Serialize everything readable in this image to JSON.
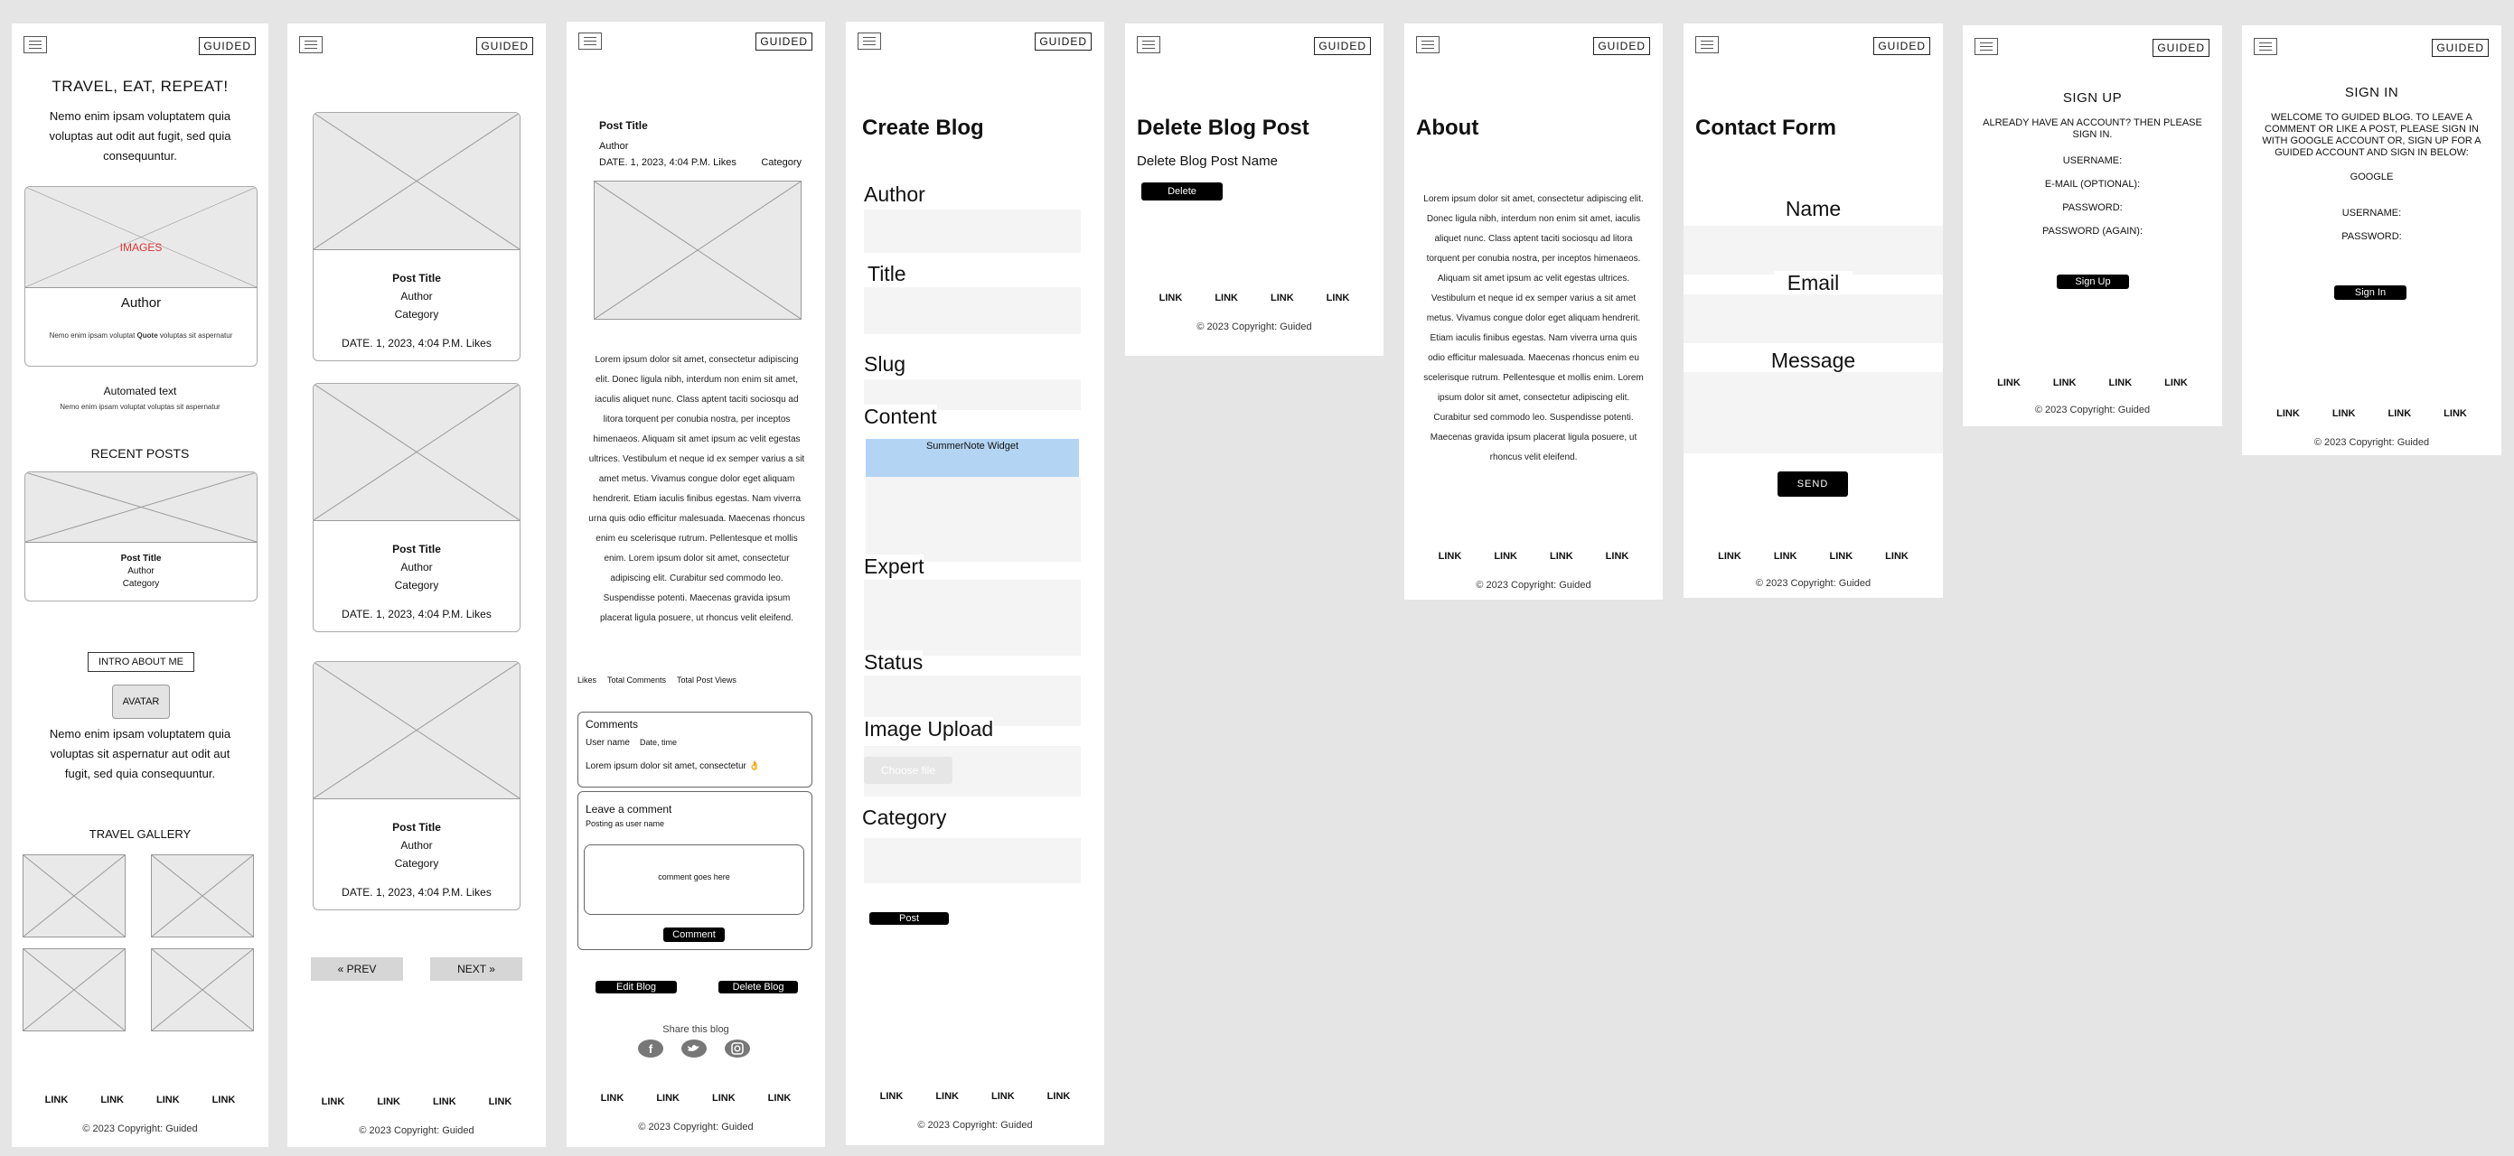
{
  "brand": "GUIDED",
  "footer": {
    "links": [
      "LINK",
      "LINK",
      "LINK",
      "LINK"
    ],
    "copyright": "© 2023 Copyright: Guided"
  },
  "home": {
    "title": "TRAVEL, EAT, REPEAT!",
    "intro": "Nemo enim ipsam voluptatem quia voluptas  aut odit aut fugit, sed quia consequuntur.",
    "featured_label": "IMAGES",
    "featured_author": "Author",
    "featured_quote_pre": "Nemo enim ipsam voluptat",
    "featured_quote_bold": "Quote",
    "featured_quote_post": "voluptas sit aspernatur",
    "automated_title": "Automated text",
    "automated_sub": "Nemo enim ipsam voluptat  voluptas sit aspernatur",
    "recent_heading": "RECENT POSTS",
    "recent_post": {
      "title": "Post Title",
      "author": "Author",
      "category": "Category"
    },
    "intro_about_me": "INTRO ABOUT ME",
    "avatar": "AVATAR",
    "about_text": "Nemo enim ipsam voluptatem quia voluptas sit aspernatur aut odit aut fugit, sed quia consequuntur.",
    "gallery_heading": "TRAVEL GALLERY"
  },
  "list": {
    "posts": [
      {
        "title": "Post Title",
        "author": "Author",
        "category": "Category",
        "meta": "DATE. 1, 2023, 4:04 P.M. Likes"
      },
      {
        "title": "Post Title",
        "author": "Author",
        "category": "Category",
        "meta": "DATE. 1, 2023, 4:04 P.M. Likes"
      },
      {
        "title": "Post Title",
        "author": "Author",
        "category": "Category",
        "meta": "DATE. 1, 2023, 4:04 P.M. Likes"
      }
    ],
    "prev": "« PREV",
    "next": "NEXT »"
  },
  "detail": {
    "title": "Post Title",
    "author": "Author",
    "meta": "DATE. 1, 2023, 4:04 P.M. Likes",
    "category": "Category",
    "body": "Lorem ipsum dolor sit amet, consectetur adipiscing elit. Donec ligula nibh, interdum non enim sit amet, iaculis aliquet nunc. Class aptent taciti sociosqu ad litora torquent per conubia nostra, per inceptos himenaeos. Aliquam sit amet ipsum ac velit egestas ultrices. Vestibulum et neque id ex semper varius a sit amet metus. Vivamus congue dolor eget aliquam hendrerit. Etiam iaculis finibus egestas. Nam viverra urna quis odio efficitur malesuada. Maecenas rhoncus enim eu scelerisque rutrum. Pellentesque et mollis enim. Lorem ipsum dolor sit amet, consectetur adipiscing elit. Curabitur sed commodo leo. Suspendisse potenti. Maecenas gravida ipsum placerat ligula posuere, ut rhoncus velit eleifend.",
    "stats": [
      "Likes",
      "Total Comments",
      "Total Post Views"
    ],
    "comments_heading": "Comments",
    "comment_user": "User name",
    "comment_date": "Date, time",
    "comment_text": "Lorem ipsum dolor sit amet, consectetur 👌",
    "leave_heading": "Leave a comment",
    "posting_as": "Posting as user name",
    "comment_placeholder": "comment goes here",
    "comment_button": "Comment",
    "edit_button": "Edit Blog",
    "delete_button": "Delete Blog",
    "share_label": "Share this blog"
  },
  "create": {
    "title": "Create Blog",
    "fields": {
      "author": "Author",
      "title": "Title",
      "slug": "Slug",
      "content": "Content",
      "expert": "Expert",
      "status": "Status",
      "image_upload": "Image Upload",
      "category": "Category"
    },
    "widget": "SummerNote Widget",
    "choose_file": "Choose file",
    "post_button": "Post"
  },
  "delete": {
    "title": "Delete Blog Post",
    "name": "Delete Blog Post Name",
    "button": "Delete"
  },
  "about": {
    "title": "About",
    "body": "Lorem ipsum dolor sit amet, consectetur adipiscing elit. Donec ligula nibh, interdum non enim sit amet, iaculis aliquet nunc. Class aptent taciti sociosqu ad litora torquent per conubia nostra, per inceptos himenaeos. Aliquam sit amet ipsum ac velit egestas ultrices. Vestibulum et neque id ex semper varius a sit amet metus. Vivamus congue dolor eget aliquam hendrerit. Etiam iaculis finibus egestas. Nam viverra urna quis odio efficitur malesuada. Maecenas rhoncus enim eu scelerisque rutrum. Pellentesque et mollis enim. Lorem ipsum dolor sit amet, consectetur adipiscing elit. Curabitur sed commodo leo. Suspendisse potenti. Maecenas gravida ipsum placerat ligula posuere, ut rhoncus velit eleifend."
  },
  "contact": {
    "title": "Contact Form",
    "name": "Name",
    "email": "Email",
    "message": "Message",
    "send": "SEND"
  },
  "signup": {
    "title": "SIGN UP",
    "subtitle": "ALREADY HAVE AN ACCOUNT? THEN PLEASE SIGN IN.",
    "username": "USERNAME:",
    "email": "E-MAIL (OPTIONAL):",
    "password": "PASSWORD:",
    "password_again": "PASSWORD (AGAIN):",
    "button": "Sign Up"
  },
  "signin": {
    "title": "SIGN IN",
    "subtitle": "WELCOME TO GUIDED BLOG. TO LEAVE A COMMENT OR LIKE A POST, PLEASE SIGN IN WITH GOOGLE ACCOUNT OR, SIGN UP FOR A GUIDED ACCOUNT AND SIGN IN BELOW:",
    "google": "GOOGLE",
    "username": "USERNAME:",
    "password": "PASSWORD:",
    "button": "Sign In"
  }
}
